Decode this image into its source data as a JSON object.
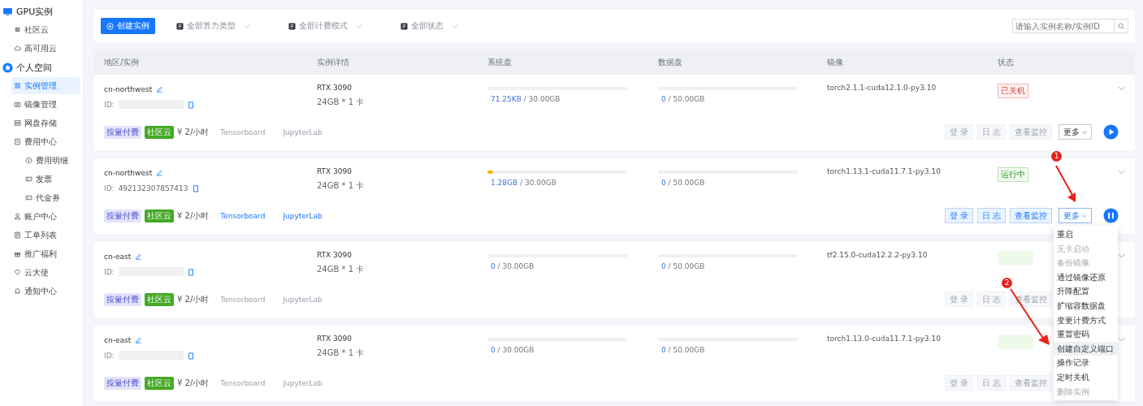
{
  "sidebar": {
    "sections": [
      {
        "title": "GPU实例",
        "items": [
          {
            "label": "社区云",
            "selected": false
          },
          {
            "label": "高可用云",
            "selected": false
          }
        ]
      },
      {
        "title": "个人空间",
        "items": [
          {
            "label": "实例管理",
            "selected": true
          },
          {
            "label": "镜像管理",
            "selected": false
          },
          {
            "label": "网盘存储",
            "selected": false
          },
          {
            "label": "费用中心",
            "selected": false,
            "children": [
              {
                "label": "费用明细",
                "selected": false
              },
              {
                "label": "发票",
                "selected": false
              },
              {
                "label": "代金券",
                "selected": false
              }
            ]
          },
          {
            "label": "账户中心",
            "selected": false
          },
          {
            "label": "工单列表",
            "selected": false
          },
          {
            "label": "推广福利",
            "selected": false
          },
          {
            "label": "云大使",
            "selected": false
          },
          {
            "label": "通知中心",
            "selected": false
          }
        ]
      }
    ]
  },
  "toolbar": {
    "create_button": "创建实例",
    "filters": [
      "全部算力类型",
      "全部计费模式",
      "全部状态"
    ],
    "search": {
      "placeholder": "请输入实例名称/实例ID"
    }
  },
  "table": {
    "columns": [
      "地区/实例",
      "实例详情",
      "系统盘",
      "数据盘",
      "镜像",
      "状态"
    ],
    "rows": [
      {
        "region": "cn-northwest",
        "id_label": "ID:",
        "id_redacted": true,
        "gpu": "RTX 3090",
        "spec": "24GB * 1 卡",
        "sys_disk": {
          "used": "71.25KB",
          "total": " / 30.00GB",
          "level": 0
        },
        "data_disk": {
          "used": "0",
          "total": " / 50.00GB",
          "level": 0
        },
        "image": "torch2.1.1-cuda12.1.0-py3.10",
        "status": {
          "kind": "stopped",
          "label": "已关机"
        },
        "billing": "按量付费",
        "cloud": "社区云",
        "price": "¥ 2/小时",
        "tools": [
          "Tensorboard",
          "JupyterLab"
        ],
        "tools_enabled": false,
        "actions": [
          "登 录",
          "日 志",
          "查看监控",
          "更多"
        ],
        "actions_enabled": false,
        "power_button": {
          "kind": "play"
        }
      },
      {
        "region": "cn-northwest",
        "id_label": "ID:",
        "id": "492132307857413",
        "id_redacted": false,
        "gpu": "RTX 3090",
        "spec": "24GB * 1 卡",
        "sys_disk": {
          "used": "1.28GB",
          "total": " / 30.00GB",
          "level": 0.04
        },
        "data_disk": {
          "used": "0",
          "total": " / 50.00GB",
          "level": 0
        },
        "image": "torch1.13.1-cuda11.7.1-py3.10",
        "status": {
          "kind": "running",
          "label": "运行中"
        },
        "billing": "按量付费",
        "cloud": "社区云",
        "price": "¥ 2/小时",
        "tools": [
          "Tensorboard",
          "JupyterLab"
        ],
        "tools_enabled": true,
        "actions": [
          "登 录",
          "日 志",
          "查看监控",
          "更多"
        ],
        "actions_enabled": true,
        "power_button": {
          "kind": "pause"
        }
      },
      {
        "region": "cn-east",
        "id_label": "ID:",
        "id_redacted": true,
        "gpu": "RTX 3090",
        "spec": "24GB * 1 卡",
        "sys_disk": {
          "used": "0",
          "total": " / 30.00GB",
          "level": 0
        },
        "data_disk": {
          "used": "0",
          "total": " / 50.00GB",
          "level": 0
        },
        "image": "tf2.15.0-cuda12.2.2-py3.10",
        "status": {
          "kind": "blurred"
        },
        "billing": "按量付费",
        "cloud": "社区云",
        "price": "¥ 2/小时",
        "tools": [
          "Tensorboard",
          "JupyterLab"
        ],
        "tools_enabled": false,
        "actions": [
          "登 录",
          "日 志",
          "查看监控"
        ],
        "actions_enabled": false
      },
      {
        "region": "cn-east",
        "id_label": "ID:",
        "id_redacted": true,
        "gpu": "RTX 3090",
        "spec": "24GB * 1 卡",
        "sys_disk": {
          "used": "0",
          "total": " / 30.00GB",
          "level": 0
        },
        "data_disk": {
          "used": "0",
          "total": " / 50.00GB",
          "level": 0
        },
        "image": "torch1.13.0-cuda11.7.1-py3.10",
        "status": {
          "kind": "blurred"
        },
        "billing": "按量付费",
        "cloud": "社区云",
        "price": "¥ 2/小时",
        "tools": [
          "Tensorboard",
          "JupyterLab"
        ],
        "tools_enabled": false,
        "actions": [
          "登 录",
          "日 志",
          "查看监控"
        ],
        "actions_enabled": false
      }
    ]
  },
  "more_menu": {
    "items": [
      {
        "label": "重启",
        "disabled": false,
        "selected": false
      },
      {
        "label": "无卡启动",
        "disabled": true,
        "selected": false
      },
      {
        "label": "备份镜像",
        "disabled": true,
        "selected": false
      },
      {
        "label": "通过镜像还原",
        "disabled": false,
        "selected": false
      },
      {
        "label": "升降配置",
        "disabled": false,
        "selected": false
      },
      {
        "label": "扩缩容数据盘",
        "disabled": false,
        "selected": false
      },
      {
        "label": "变更计费方式",
        "disabled": false,
        "selected": false
      },
      {
        "label": "重置密码",
        "disabled": false,
        "selected": false
      },
      {
        "label": "创建自定义端口",
        "disabled": false,
        "selected": true
      },
      {
        "label": "操作记录",
        "disabled": false,
        "selected": false
      },
      {
        "label": "定时关机",
        "disabled": false,
        "selected": false
      },
      {
        "label": "删除实例",
        "disabled": true,
        "selected": false
      }
    ]
  },
  "annotations": [
    {
      "label": "1"
    },
    {
      "label": "2"
    }
  ]
}
